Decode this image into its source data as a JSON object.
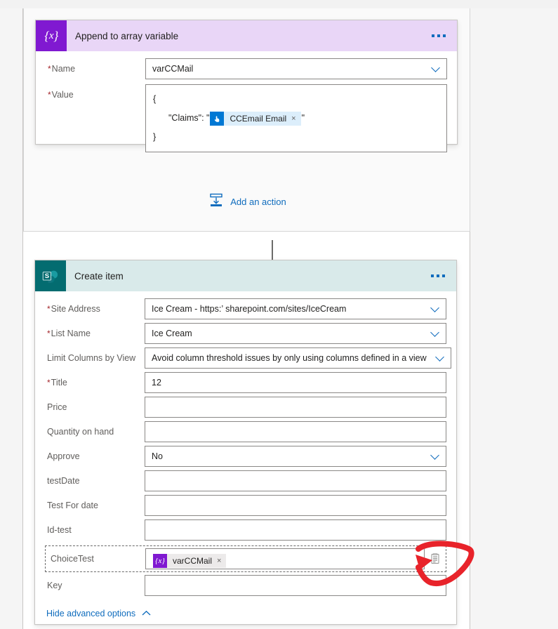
{
  "append_card": {
    "title": "Append to array variable",
    "icon": "variable-braces-icon",
    "menu": "more-commands",
    "fields": {
      "name": {
        "label": "Name",
        "required": true,
        "value": "varCCMail",
        "control": "combobox"
      },
      "value": {
        "label": "Value",
        "required": true,
        "control": "multiline",
        "line1": "{",
        "line2_prefix": "\"Claims\": \"",
        "line2_suffix": "\"",
        "line3": "}",
        "token": {
          "icon": "touch-hand-icon",
          "label": "CCEmail Email",
          "remove": "×"
        }
      }
    }
  },
  "add_action": {
    "label": "Add an action",
    "icon": "insert-action-icon"
  },
  "connector": {
    "icon": "down-arrow-icon"
  },
  "create_card": {
    "title": "Create item",
    "icon": "sharepoint-icon",
    "menu": "more-commands",
    "fields": [
      {
        "label": "Site Address",
        "required": true,
        "control": "combobox",
        "value": "Ice Cream - https:’                 sharepoint.com/sites/IceCream"
      },
      {
        "label": "List Name",
        "required": true,
        "control": "combobox",
        "value": "Ice Cream"
      },
      {
        "label": "Limit Columns by View",
        "required": false,
        "control": "combobox",
        "value": "Avoid column threshold issues by only using columns defined in a view"
      },
      {
        "label": "Title",
        "required": true,
        "control": "text",
        "value": "12"
      },
      {
        "label": "Price",
        "required": false,
        "control": "text",
        "value": ""
      },
      {
        "label": "Quantity on hand",
        "required": false,
        "control": "text",
        "value": ""
      },
      {
        "label": "Approve",
        "required": false,
        "control": "combobox",
        "value": "No"
      },
      {
        "label": "testDate",
        "required": false,
        "control": "text",
        "value": ""
      },
      {
        "label": "Test For date",
        "required": false,
        "control": "text",
        "value": ""
      },
      {
        "label": "Id-test",
        "required": false,
        "control": "text",
        "value": ""
      }
    ],
    "choice_row": {
      "label": "ChoiceTest",
      "token": {
        "icon": "variable-braces-icon",
        "label": "varCCMail",
        "remove": "×"
      },
      "picker_icon": "dynamic-content-picker-icon"
    },
    "key_row": {
      "label": "Key",
      "value": ""
    },
    "advanced": {
      "label": "Hide advanced options",
      "icon": "chevron-up-icon"
    }
  },
  "annotation": {
    "shape": "red-hand-drawn-arrow-loop",
    "color": "#e8232a"
  },
  "colors": {
    "variable_purple": "#8019d1",
    "variable_header": "#e9d6f7",
    "sharepoint_teal": "#036c70",
    "sharepoint_header": "#d9eaea",
    "link_blue": "#0f6cbd",
    "token_blue": "#0078d4",
    "required_red": "#a4262c"
  }
}
